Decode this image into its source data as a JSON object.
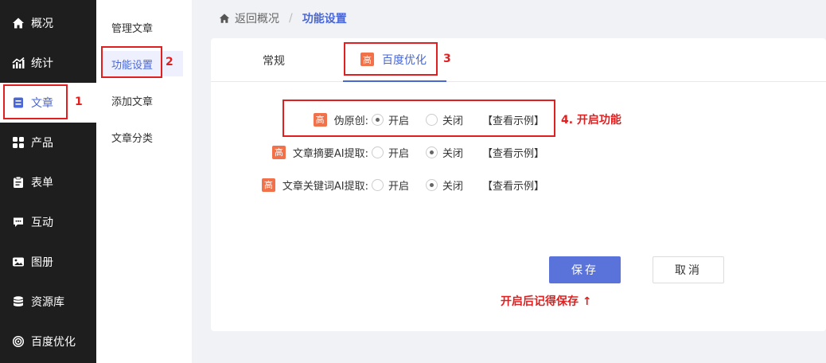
{
  "sidebar": {
    "items": [
      {
        "label": "概况",
        "icon": "home-icon"
      },
      {
        "label": "统计",
        "icon": "chart-icon"
      },
      {
        "label": "文章",
        "icon": "article-icon"
      },
      {
        "label": "产品",
        "icon": "grid-icon"
      },
      {
        "label": "表单",
        "icon": "clipboard-icon"
      },
      {
        "label": "互动",
        "icon": "chat-icon"
      },
      {
        "label": "图册",
        "icon": "image-icon"
      },
      {
        "label": "资源库",
        "icon": "database-icon"
      },
      {
        "label": "百度优化",
        "icon": "target-icon"
      }
    ]
  },
  "submenu": {
    "items": [
      {
        "label": "管理文章"
      },
      {
        "label": "功能设置"
      },
      {
        "label": "添加文章"
      },
      {
        "label": "文章分类"
      }
    ]
  },
  "breadcrumb": {
    "back": "返回概况",
    "separator": "/",
    "current": "功能设置"
  },
  "tabs": [
    {
      "label": "常规"
    },
    {
      "label": "百度优化",
      "badge": "高"
    }
  ],
  "settings": [
    {
      "badge": "高",
      "label": "伪原创:",
      "on": "开启",
      "off": "关闭",
      "selected": "on",
      "example": "【查看示例】"
    },
    {
      "badge": "高",
      "label": "文章摘要AI提取:",
      "on": "开启",
      "off": "关闭",
      "selected": "off",
      "example": "【查看示例】"
    },
    {
      "badge": "高",
      "label": "文章关键词AI提取:",
      "on": "开启",
      "off": "关闭",
      "selected": "off",
      "example": "【查看示例】"
    }
  ],
  "buttons": {
    "save": "保存",
    "cancel": "取消"
  },
  "annotations": {
    "n1": "1",
    "n2": "2",
    "n3": "3",
    "n4": "4. 开启功能",
    "reminder": "开启后记得保存 ↑"
  },
  "colors": {
    "accent": "#4a67d6",
    "badge": "#f0714a",
    "annotation": "#e02020",
    "sidebar_bg": "#1e1e1e"
  }
}
